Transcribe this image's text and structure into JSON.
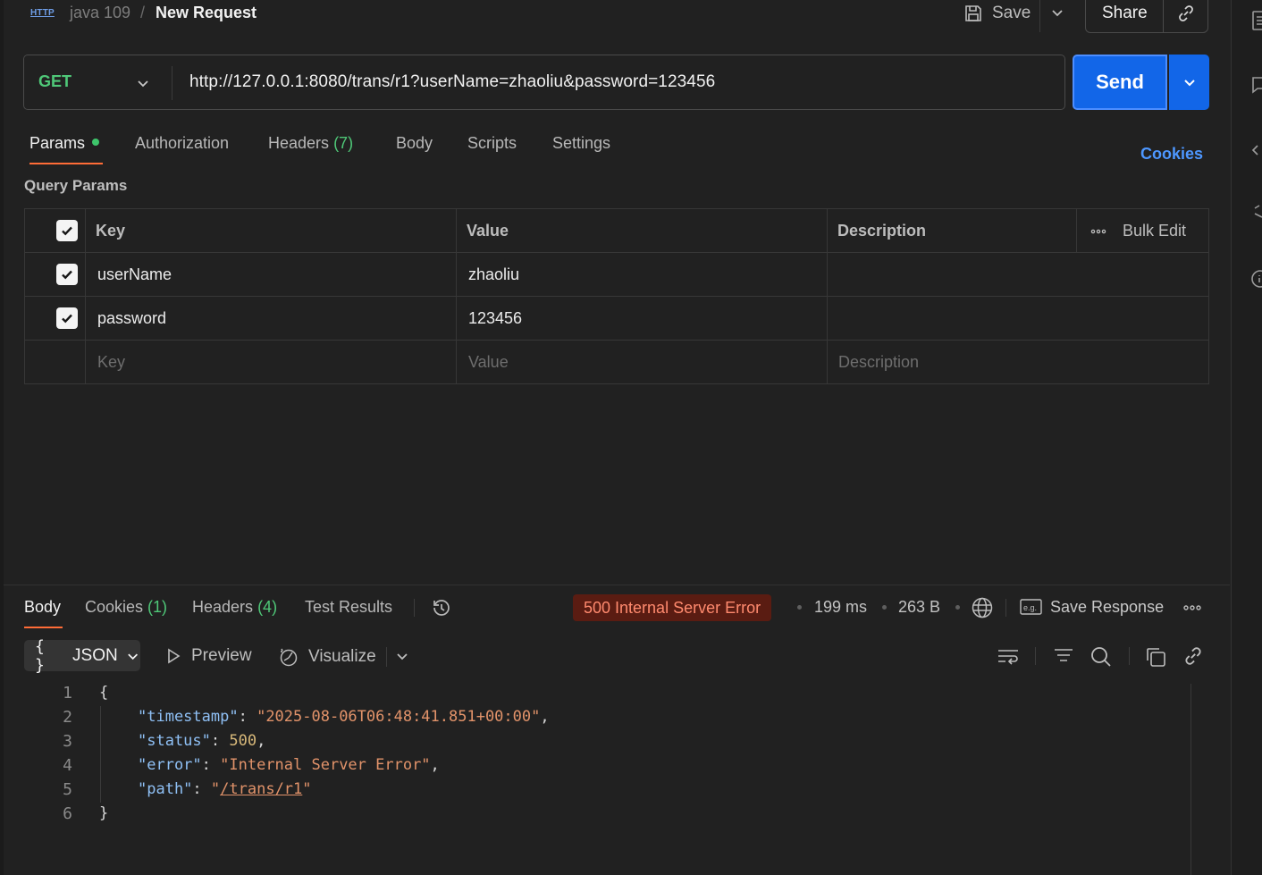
{
  "header": {
    "type_badge": "HTTP",
    "collection": "java 109",
    "separator": "/",
    "title": "New Request",
    "save_label": "Save",
    "share_label": "Share"
  },
  "request": {
    "method": "GET",
    "url": "http://127.0.0.1:8080/trans/r1?userName=zhaoliu&password=123456",
    "send_label": "Send"
  },
  "request_tabs": {
    "params": "Params",
    "authorization": "Authorization",
    "headers": "Headers",
    "headers_count": "(7)",
    "body": "Body",
    "scripts": "Scripts",
    "settings": "Settings",
    "cookies": "Cookies"
  },
  "query_params": {
    "label": "Query Params",
    "columns": {
      "key": "Key",
      "value": "Value",
      "description": "Description",
      "bulk_edit": "Bulk Edit"
    },
    "rows": [
      {
        "key": "userName",
        "value": "zhaoliu",
        "description": ""
      },
      {
        "key": "password",
        "value": "123456",
        "description": ""
      }
    ],
    "placeholders": {
      "key": "Key",
      "value": "Value",
      "description": "Description"
    }
  },
  "response": {
    "tabs": {
      "body": "Body",
      "cookies": "Cookies",
      "cookies_count": "(1)",
      "headers": "Headers",
      "headers_count": "(4)",
      "test_results": "Test Results"
    },
    "status": "500 Internal Server Error",
    "status_color": "#ff8a6e",
    "time": "199 ms",
    "size": "263 B",
    "save_response": "Save Response",
    "format": "JSON",
    "format_icon": "{ }",
    "preview": "Preview",
    "visualize": "Visualize",
    "code_lines": {
      "l1": "{",
      "l2_key": "\"timestamp\"",
      "l2_val": "\"2025-08-06T06:48:41.851+00:00\"",
      "l3_key": "\"status\"",
      "l3_val": "500",
      "l4_key": "\"error\"",
      "l4_val": "\"Internal Server Error\"",
      "l5_key": "\"path\"",
      "l5_val": "/trans/r1",
      "l6": "}"
    }
  },
  "colors": {
    "accent": "#ff6c37",
    "send": "#1266e8",
    "method_get": "#4fc878",
    "link": "#4d97ff"
  }
}
